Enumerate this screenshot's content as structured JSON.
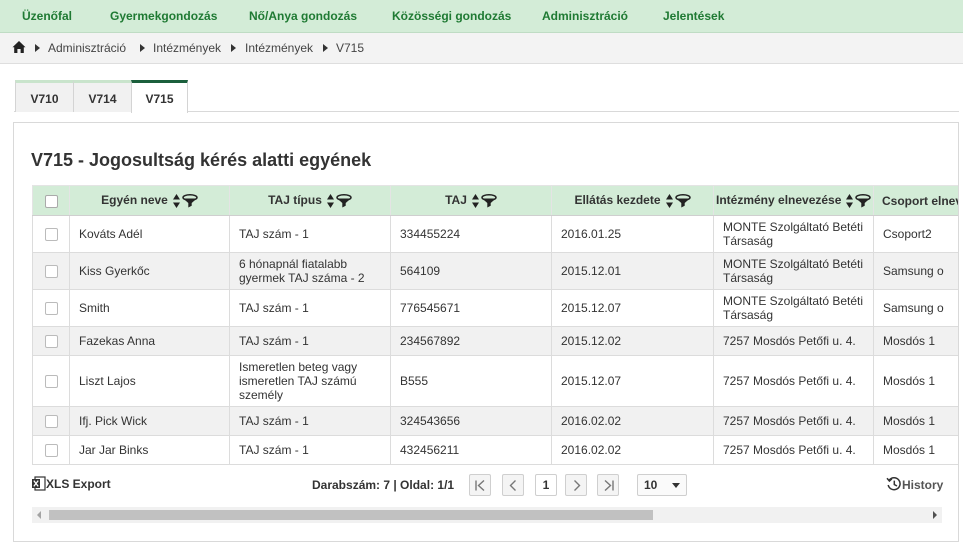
{
  "topnav": {
    "items": [
      "Üzenőfal",
      "Gyermekgondozás",
      "Nő/Anya gondozás",
      "Közösségi gondozás",
      "Adminisztráció",
      "Jelentések"
    ]
  },
  "breadcrumb": {
    "home_icon": "home-icon",
    "items": [
      "Adminisztráció",
      "Intézmények",
      "Intézmények",
      "V715"
    ]
  },
  "tabs": [
    {
      "label": "V710",
      "active": false
    },
    {
      "label": "V714",
      "active": false
    },
    {
      "label": "V715",
      "active": true
    }
  ],
  "panel": {
    "title": "V715 - Jogosultság kérés alatti egyének"
  },
  "grid": {
    "columns": [
      "Egyén neve",
      "TAJ típus",
      "TAJ",
      "Ellátás kezdete",
      "Intézmény elnevezése",
      "Csoport elnevezése"
    ],
    "rows": [
      {
        "name": "Kováts Adél",
        "taj_type": "TAJ szám - 1",
        "taj": "334455224",
        "start": "2016.01.25",
        "institution": "MONTE Szolgáltató Betéti Társaság",
        "group": "Csoport2"
      },
      {
        "name": "Kiss Gyerkőc",
        "taj_type": "6 hónapnál fiatalabb gyermek TAJ száma - 2",
        "taj": "564109",
        "start": "2015.12.01",
        "institution": "MONTE Szolgáltató Betéti Társaság",
        "group": "Samsung o"
      },
      {
        "name": "Smith",
        "taj_type": "TAJ szám - 1",
        "taj": "776545671",
        "start": "2015.12.07",
        "institution": "MONTE Szolgáltató Betéti Társaság",
        "group": "Samsung o"
      },
      {
        "name": "Fazekas Anna",
        "taj_type": "TAJ szám - 1",
        "taj": "234567892",
        "start": "2015.12.02",
        "institution": "7257 Mosdós Petőfi u. 4.",
        "group": "Mosdós 1"
      },
      {
        "name": "Liszt Lajos",
        "taj_type": "Ismeretlen beteg vagy ismeretlen TAJ számú személy",
        "taj": "B555",
        "start": "2015.12.07",
        "institution": "7257 Mosdós Petőfi u. 4.",
        "group": "Mosdós 1"
      },
      {
        "name": "Ifj. Pick Wick",
        "taj_type": "TAJ szám - 1",
        "taj": "324543656",
        "start": "2016.02.02",
        "institution": "7257 Mosdós Petőfi u. 4.",
        "group": "Mosdós 1"
      },
      {
        "name": "Jar Jar Binks",
        "taj_type": "TAJ szám - 1",
        "taj": "432456211",
        "start": "2016.02.02",
        "institution": "7257 Mosdós Petőfi u. 4.",
        "group": "Mosdós 1"
      }
    ]
  },
  "footer": {
    "xls_label": "XLS Export",
    "count_text": "Darabszám: 7 | Oldal: 1/1",
    "current_page": "1",
    "page_size": "10",
    "history_label": "History"
  },
  "colors": {
    "nav_bg": "#d3ecd7",
    "nav_text": "#1f7a33",
    "active_tab_accent": "#1b5f3c",
    "header_bg": "#d3ecd7"
  }
}
